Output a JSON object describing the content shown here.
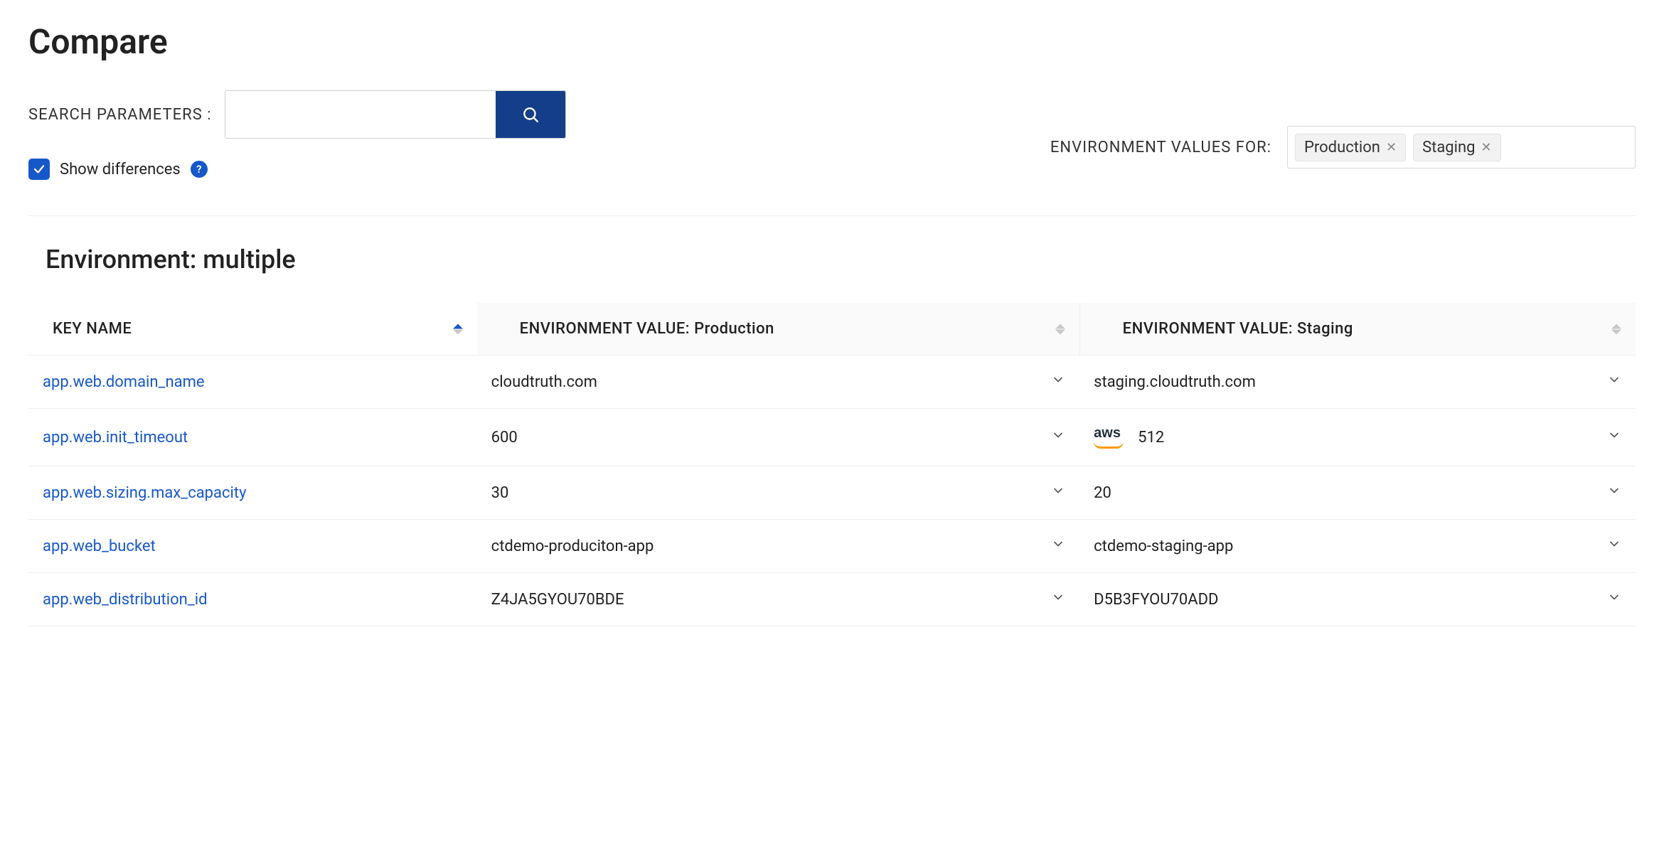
{
  "page_title": "Compare",
  "search": {
    "label": "SEARCH PARAMETERS :",
    "value": "",
    "placeholder": ""
  },
  "show_diff": {
    "label": "Show differences",
    "checked": true,
    "help": "?"
  },
  "env_selector": {
    "label": "ENVIRONMENT VALUES FOR:",
    "tags": [
      "Production",
      "Staging"
    ]
  },
  "section_title": "Environment: multiple",
  "columns": {
    "key": "KEY NAME",
    "envs": [
      "ENVIRONMENT VALUE: Production",
      "ENVIRONMENT VALUE: Staging"
    ]
  },
  "rows": [
    {
      "key": "app.web.domain_name",
      "values": [
        {
          "text": "cloudtruth.com"
        },
        {
          "text": "staging.cloudtruth.com"
        }
      ]
    },
    {
      "key": "app.web.init_timeout",
      "values": [
        {
          "text": "600"
        },
        {
          "text": "512",
          "aws": true
        }
      ]
    },
    {
      "key": "app.web.sizing.max_capacity",
      "values": [
        {
          "text": "30"
        },
        {
          "text": "20"
        }
      ]
    },
    {
      "key": "app.web_bucket",
      "values": [
        {
          "text": "ctdemo-produciton-app"
        },
        {
          "text": "ctdemo-staging-app"
        }
      ]
    },
    {
      "key": "app.web_distribution_id",
      "values": [
        {
          "text": "Z4JA5GYOU70BDE"
        },
        {
          "text": "D5B3FYOU70ADD"
        }
      ]
    }
  ]
}
